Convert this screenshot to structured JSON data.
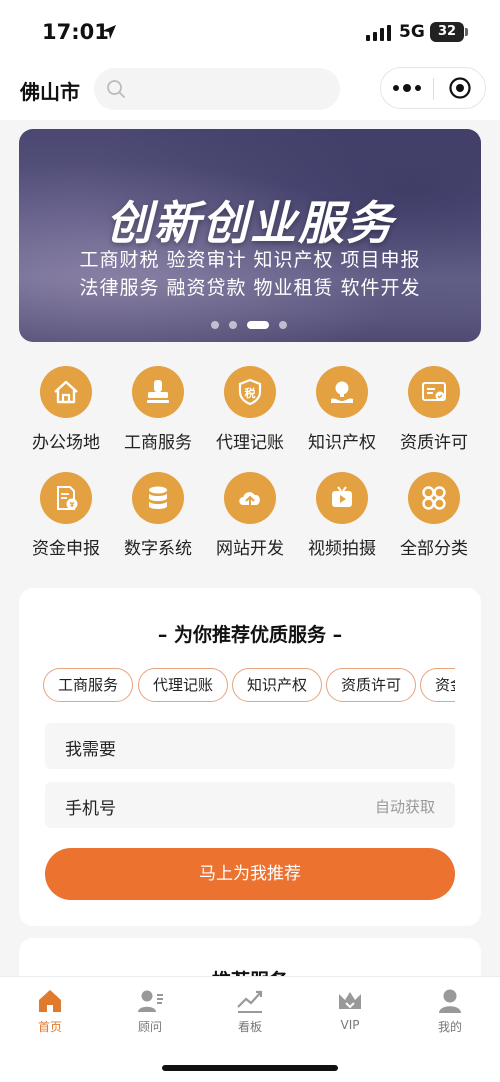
{
  "status_bar": {
    "time": "17:01",
    "network": "5G",
    "battery": "32"
  },
  "header": {
    "city": "佛山市",
    "search_placeholder": "",
    "capsule_more": "more-icon",
    "capsule_close": "record-icon"
  },
  "banner": {
    "title": "创新创业服务",
    "line1": "工商财税 验资审计 知识产权 项目申报",
    "line2": "法律服务 融资贷款 物业租赁 软件开发",
    "active_dot": 3,
    "dot_count": 4
  },
  "grid": [
    {
      "label": "办公场地",
      "icon": "house-icon"
    },
    {
      "label": "工商服务",
      "icon": "stamp-icon"
    },
    {
      "label": "代理记账",
      "icon": "tax-shield-icon"
    },
    {
      "label": "知识产权",
      "icon": "idea-hand-icon"
    },
    {
      "label": "资质许可",
      "icon": "certificate-icon"
    },
    {
      "label": "资金申报",
      "icon": "money-doc-icon"
    },
    {
      "label": "数字系统",
      "icon": "database-icon"
    },
    {
      "label": "网站开发",
      "icon": "cloud-upload-icon"
    },
    {
      "label": "视频拍摄",
      "icon": "video-icon"
    },
    {
      "label": "全部分类",
      "icon": "all-grid-icon"
    }
  ],
  "recommend": {
    "title": "– 为你推荐优质服务 –",
    "chips": [
      "工商服务",
      "代理记账",
      "知识产权",
      "资质许可",
      "资金申报"
    ],
    "need_label": "我需要",
    "phone_label": "手机号",
    "phone_hint": "自动获取",
    "submit": "马上为我推荐"
  },
  "section2": {
    "title": "推荐服务"
  },
  "tabs": [
    {
      "label": "首页",
      "icon": "home-icon",
      "active": true
    },
    {
      "label": "顾问",
      "icon": "consultant-icon",
      "active": false
    },
    {
      "label": "看板",
      "icon": "chart-board-icon",
      "active": false
    },
    {
      "label": "VIP",
      "icon": "crown-icon",
      "active": false
    },
    {
      "label": "我的",
      "icon": "user-icon",
      "active": false
    }
  ],
  "colors": {
    "accent": "#ec7230",
    "icon_gold": "#e3a142",
    "tab_active": "#e07a2c"
  }
}
